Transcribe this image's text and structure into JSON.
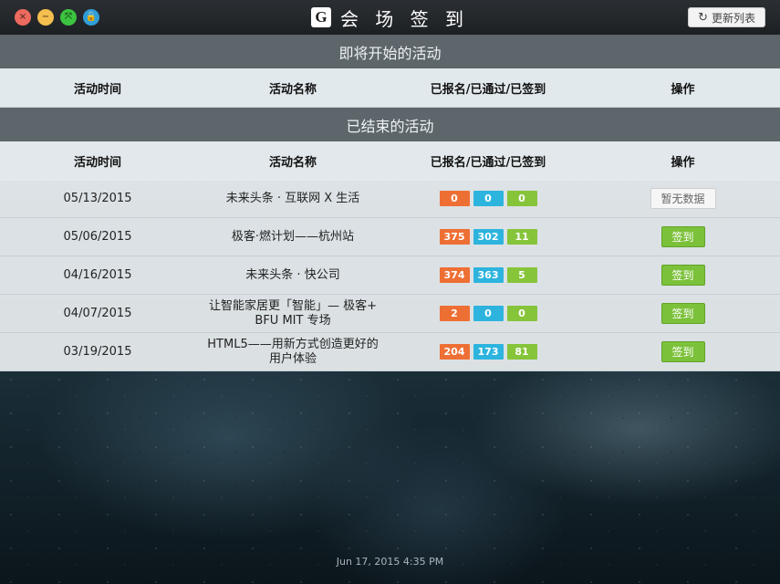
{
  "window": {
    "title": "会 场 签 到",
    "logo_letter": "G",
    "refresh_label": "更新列表",
    "controls": {
      "close": "×",
      "minimize": "−",
      "fullscreen": "⤧",
      "lock": "🔒"
    }
  },
  "upcoming": {
    "header": "即将开始的活动",
    "columns": [
      "活动时间",
      "活动名称",
      "已报名/已通过/已签到",
      "操作"
    ]
  },
  "ended": {
    "header": "已结束的活动",
    "columns": [
      "活动时间",
      "活动名称",
      "已报名/已通过/已签到",
      "操作"
    ],
    "rows": [
      {
        "date": "05/13/2015",
        "name": "未来头条 · 互联网 X 生活",
        "registered": "0",
        "approved": "0",
        "checked_in": "0",
        "action": "暂无数据"
      },
      {
        "date": "05/06/2015",
        "name": "极客·燃计划——杭州站",
        "registered": "375",
        "approved": "302",
        "checked_in": "11",
        "action": "签到"
      },
      {
        "date": "04/16/2015",
        "name": "未来头条 · 快公司",
        "registered": "374",
        "approved": "363",
        "checked_in": "5",
        "action": "签到"
      },
      {
        "date": "04/07/2015",
        "name": "让智能家居更「智能」— 极客+ BFU MIT 专场",
        "registered": "2",
        "approved": "0",
        "checked_in": "0",
        "action": "签到"
      },
      {
        "date": "03/19/2015",
        "name": "HTML5——用新方式创造更好的用户体验",
        "registered": "204",
        "approved": "173",
        "checked_in": "81",
        "action": "签到"
      }
    ]
  },
  "timestamp": "Jun 17, 2015 4:35 PM",
  "colors": {
    "orange": "#ee6f34",
    "blue": "#2db4de",
    "green": "#86c43a",
    "signin": "#7cc13a"
  }
}
